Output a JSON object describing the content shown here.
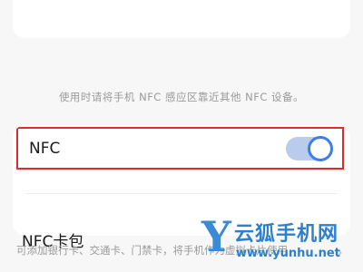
{
  "hint": "使用时请将手机 NFC 感应区靠近其他 NFC 设备。",
  "nfc": {
    "label": "NFC",
    "toggle_on": true,
    "toggle_color": "#3f7ee8"
  },
  "wallet": {
    "title": "NFC卡包",
    "description": "可添加银行卡、交通卡、门禁卡，将手机作为虚拟卡片使用",
    "chevron": "›"
  },
  "watermark": {
    "logo_letter": "Y",
    "name": "云狐手机网",
    "url": "www.yunhu.net"
  },
  "colors": {
    "highlight_border": "#e02b2b",
    "accent": "#3f7ee8",
    "watermark": "#2d7fd0"
  }
}
